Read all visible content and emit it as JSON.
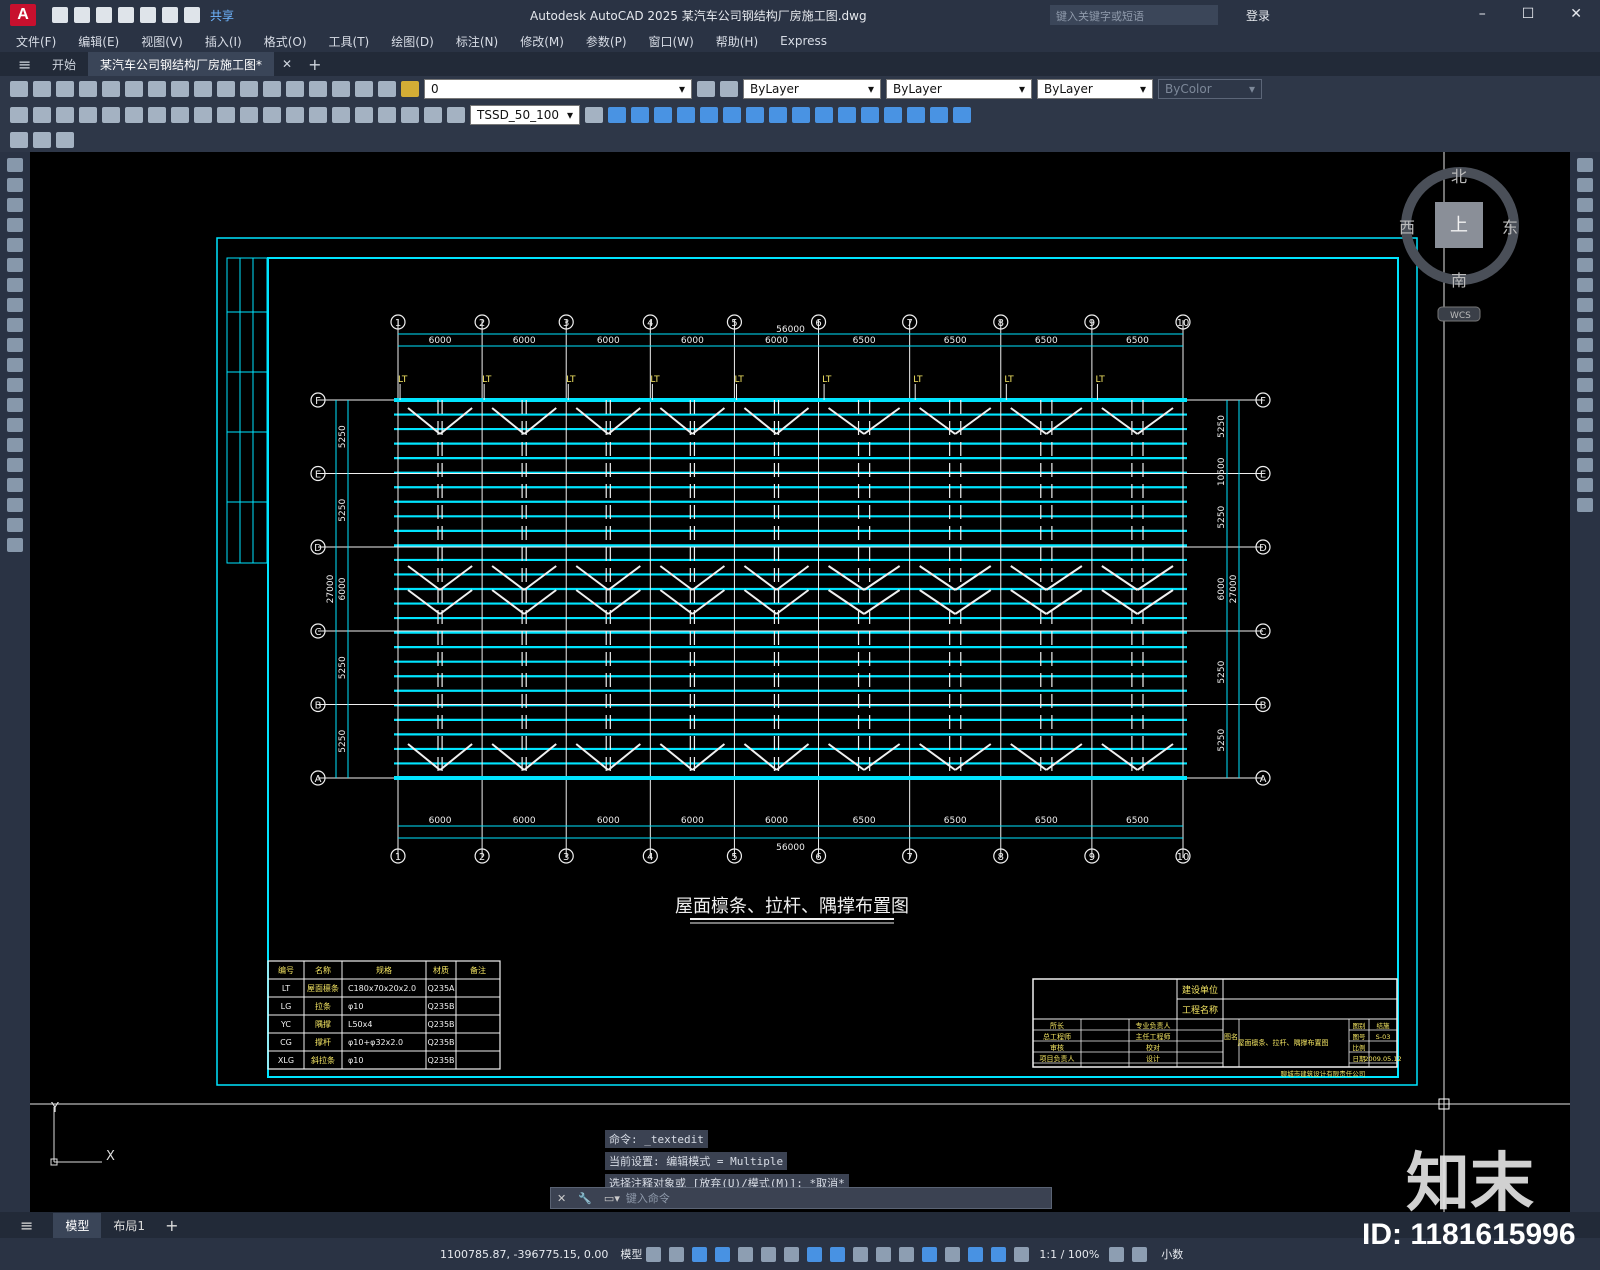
{
  "titlebar": {
    "app_logo": "A",
    "share_label": "共享",
    "title": "Autodesk AutoCAD 2025    某汽车公司钢结构厂房施工图.dwg",
    "search_placeholder": "键入关键字或短语",
    "login_label": "登录"
  },
  "menu": [
    "文件(F)",
    "编辑(E)",
    "视图(V)",
    "插入(I)",
    "格式(O)",
    "工具(T)",
    "绘图(D)",
    "标注(N)",
    "修改(M)",
    "参数(P)",
    "窗口(W)",
    "帮助(H)",
    "Express"
  ],
  "tabs": [
    {
      "label": "开始"
    },
    {
      "label": "某汽车公司钢结构厂房施工图*"
    }
  ],
  "toolbar": {
    "layer_value": "0",
    "color_value": "ByLayer",
    "linetype_value": "ByLayer",
    "lineweight_value": "ByLayer",
    "plotstyle_value": "ByColor",
    "dimstyle_value": "TSSD_50_100"
  },
  "viewcube": {
    "north": "北",
    "south": "南",
    "east": "东",
    "west": "西",
    "top": "上",
    "wcs": "WCS"
  },
  "drawing": {
    "title": "屋面檩条、拉杆、隅撑布置图",
    "axes_x": [
      "1",
      "2",
      "3",
      "4",
      "5",
      "6",
      "7",
      "8",
      "9",
      "10"
    ],
    "axes_y": [
      "F",
      "E",
      "D",
      "C",
      "B",
      "A"
    ],
    "dim_x_spans": [
      "6000",
      "6000",
      "6000",
      "6000",
      "6000",
      "6500",
      "6500",
      "6500",
      "6500"
    ],
    "dim_x_total": "56000",
    "dim_y_left": [
      "5250",
      "5250",
      "6000",
      "5250",
      "5250"
    ],
    "dim_y_total": "27000",
    "dim_y_right": [
      "5250",
      "10500",
      "5250",
      "6000",
      "27000",
      "5250",
      "5250"
    ],
    "lt_label": "LT",
    "members_table": {
      "headers": [
        "编号",
        "名称",
        "规格",
        "材质",
        "备注"
      ],
      "rows": [
        [
          "LT",
          "屋面檩条",
          "C180x70x20x2.0",
          "Q235A",
          ""
        ],
        [
          "LG",
          "拉条",
          "φ10",
          "Q235B",
          ""
        ],
        [
          "YC",
          "隅撑",
          "L50x4",
          "Q235B",
          ""
        ],
        [
          "CG",
          "撑杆",
          "φ10+φ32x2.0",
          "Q235B",
          ""
        ],
        [
          "XLG",
          "斜拉条",
          "φ10",
          "Q235B",
          ""
        ]
      ]
    },
    "titleblock": {
      "build_unit": "建设单位",
      "project_name": "工程名称",
      "roles": [
        "所长",
        "总工程师",
        "审核",
        "项目负责人"
      ],
      "roles2": [
        "专业负责人",
        "主任工程师",
        "校对",
        "设计"
      ],
      "drawing_name_label": "图名",
      "drawing_name": "屋面檩条、拉杆、隅撑布置图",
      "meta_labels": [
        "图别",
        "图号",
        "比例",
        "日期"
      ],
      "meta_values": [
        "结施",
        "S-03",
        "",
        "2009.05.12"
      ],
      "design_inst": "聊城市建筑设计有限责任公司"
    }
  },
  "command_history": [
    "命令: _textedit",
    "当前设置: 编辑模式 = Multiple",
    "选择注释对象或 [放弃(U)/模式(M)]: *取消*"
  ],
  "command_placeholder": "键入命令",
  "layouts": [
    "模型",
    "布局1"
  ],
  "status": {
    "coords": "1100785.87, -396775.15, 0.00",
    "model_label": "模型",
    "scale": "1:1 / 100%",
    "units": "小数"
  },
  "watermark": {
    "brand": "知末",
    "id": "ID: 1181615996"
  }
}
